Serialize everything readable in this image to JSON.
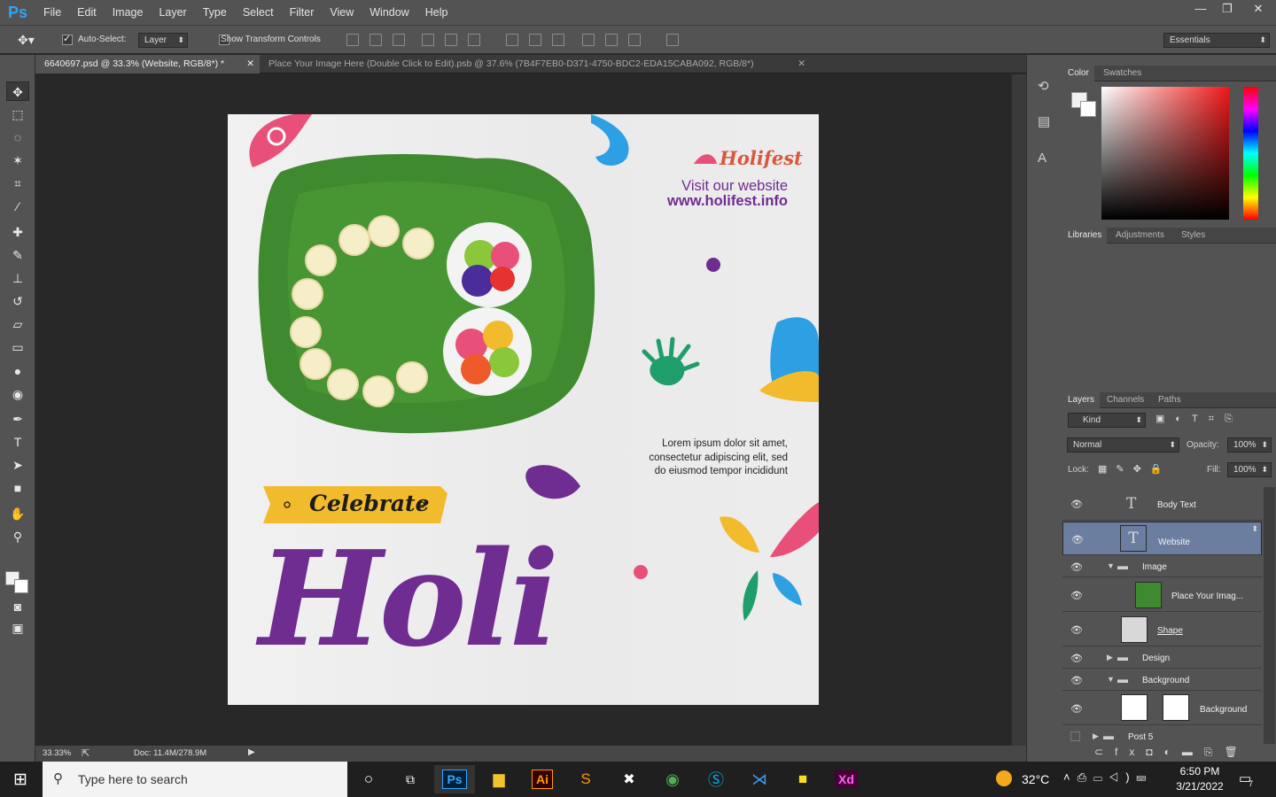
{
  "app": {
    "logo": "Ps",
    "menu": [
      "File",
      "Edit",
      "Image",
      "Layer",
      "Type",
      "Select",
      "Filter",
      "View",
      "Window",
      "Help"
    ]
  },
  "window_controls": {
    "minimize": "—",
    "maximize": "❐",
    "close": "✕"
  },
  "options": {
    "auto_select_label": "Auto-Select:",
    "auto_select_checked": true,
    "auto_select_target": "Layer",
    "transform_label": "Show Transform Controls",
    "transform_checked": false,
    "workspace": "Essentials"
  },
  "tabs": [
    {
      "label": "6640697.psd @ 33.3% (Website, RGB/8*) *",
      "active": true
    },
    {
      "label": "Place Your Image Here (Double Click to Edit).psb @ 37.6% (7B4F7EB0-D371-4750-BDC2-EDA15CABA092, RGB/8*)",
      "active": false
    }
  ],
  "tab_close": "✕",
  "design": {
    "brand": "Holifest",
    "visit": "Visit our website",
    "url": "www.holifest.info",
    "body": [
      "Lorem ipsum dolor sit amet,",
      "consectetur adipiscing elit, sed",
      "do eiusmod tempor incididunt"
    ],
    "ribbon": "Celebrate",
    "headline": "Holi",
    "colors": {
      "purple": "#6f2c91",
      "pink": "#e8507a",
      "blue": "#2d9fe3",
      "yellow": "#f2bb2d",
      "green": "#1f9e6b"
    }
  },
  "status": {
    "zoom": "33.33%",
    "doc": "Doc: 11.4M/278.9M"
  },
  "panels": {
    "color_tabs": [
      "Color",
      "Swatches"
    ],
    "lib_tabs": [
      "Libraries",
      "Adjustments",
      "Styles"
    ],
    "layer_tabs": [
      "Layers",
      "Channels",
      "Paths"
    ],
    "kind": "Kind",
    "blend": "Normal",
    "opacity_label": "Opacity:",
    "opacity": "100%",
    "lock_label": "Lock:",
    "fill_label": "Fill:",
    "fill": "100%",
    "layers": [
      {
        "name": "Body Text",
        "type": "text",
        "selected": false,
        "indent": 0,
        "visible": true
      },
      {
        "name": "Website",
        "type": "text",
        "selected": true,
        "indent": 0,
        "visible": true
      },
      {
        "name": "Image",
        "type": "group-open",
        "selected": false,
        "indent": 0,
        "visible": true
      },
      {
        "name": "Place Your Imag...",
        "type": "smart",
        "selected": false,
        "indent": 1,
        "visible": true
      },
      {
        "name": "Shape",
        "type": "shape",
        "selected": false,
        "indent": 1,
        "visible": true
      },
      {
        "name": "Design",
        "type": "group-closed",
        "selected": false,
        "indent": 0,
        "visible": true
      },
      {
        "name": "Background",
        "type": "group-open",
        "selected": false,
        "indent": 0,
        "visible": true
      },
      {
        "name": "Background",
        "type": "fill",
        "selected": false,
        "indent": 1,
        "visible": true
      },
      {
        "name": "Post 5",
        "type": "group-closed",
        "selected": false,
        "indent": -1,
        "visible": false
      }
    ]
  },
  "taskbar": {
    "search_placeholder": "Type here to search",
    "weather": "32°C",
    "time": "6:50 PM",
    "date": "3/21/2022",
    "notif": "7",
    "apps": [
      "Ps",
      "Ai",
      "Xd"
    ]
  }
}
